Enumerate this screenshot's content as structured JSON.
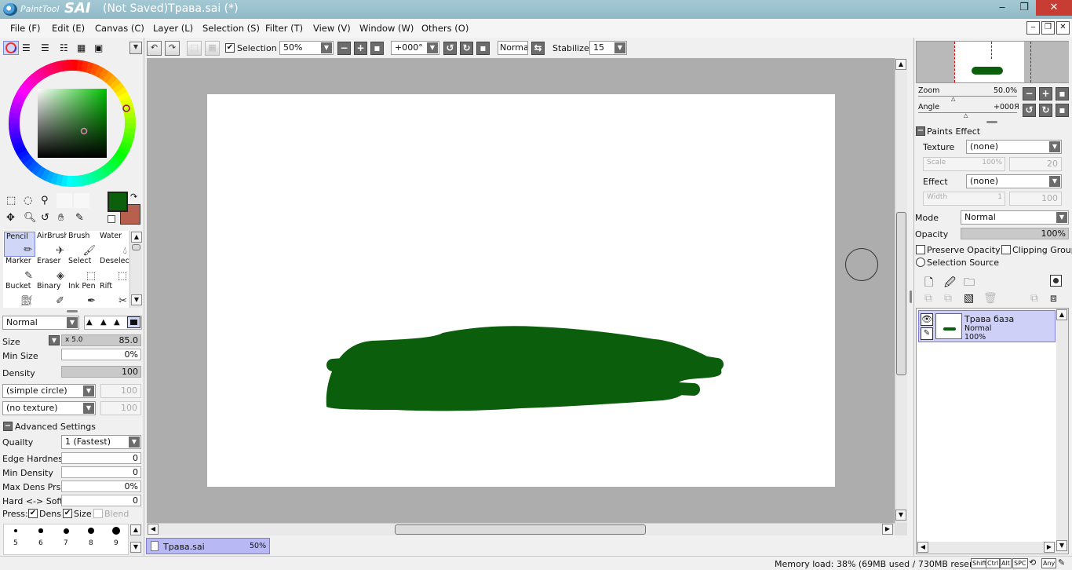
{
  "app": {
    "title": "(Not Saved)Трава.sai (*)",
    "logo_text": "PaintTool",
    "logo_brand": "SAI",
    "window_controls": [
      "‒",
      "❐",
      "✕"
    ]
  },
  "menu": [
    "File (F)",
    "Edit (E)",
    "Canvas (C)",
    "Layer (L)",
    "Selection (S)",
    "Filter (T)",
    "View (V)",
    "Window (W)",
    "Others (O)"
  ],
  "toolbar": {
    "selection_label": "Selection",
    "selection_checked": true,
    "zoom": "50%",
    "rotation": "+000°",
    "blend_mode": "Normal",
    "stabilizer_label": "Stabilizer",
    "stabilizer_value": "15"
  },
  "colors": {
    "primary": "#0c5f0c",
    "secondary": "#b8604e",
    "stroke": "#0b5e0c",
    "selection_bg": "#cfd0f8"
  },
  "tools": [
    {
      "label": "Pencil",
      "icon": "pencil-icon",
      "selected": true
    },
    {
      "label": "AirBrush",
      "icon": "airbrush-icon"
    },
    {
      "label": "Brush",
      "icon": "brush-icon"
    },
    {
      "label": "Water",
      "icon": "water-icon"
    },
    {
      "label": "Marker",
      "icon": "marker-icon"
    },
    {
      "label": "Eraser",
      "icon": "eraser-icon"
    },
    {
      "label": "Select",
      "icon": "select-icon"
    },
    {
      "label": "Deselect",
      "icon": "deselect-icon"
    },
    {
      "label": "Bucket",
      "icon": "bucket-icon"
    },
    {
      "label": "Binary",
      "icon": "binary-icon"
    },
    {
      "label": "Ink Pen",
      "icon": "ink-pen-icon"
    },
    {
      "label": "Rift",
      "icon": "rift-icon"
    }
  ],
  "brush": {
    "mode": "Normal",
    "size_label": "Size",
    "size_mult": "x 5.0",
    "size_value": "85.0",
    "min_size_label": "Min Size",
    "min_size_value": "0%",
    "density_label": "Density",
    "density_value": "100",
    "density_fraction": 1.0,
    "shape": "(simple circle)",
    "shape_value": "100",
    "texture": "(no texture)",
    "texture_value": "100"
  },
  "advanced": {
    "header": "Advanced Settings",
    "quality_label": "Quailty",
    "quality_value": "1 (Fastest)",
    "edge_hardness_label": "Edge Hardness",
    "edge_hardness_value": "0",
    "min_density_label": "Min Density",
    "min_density_value": "0",
    "max_dens_label": "Max Dens Prs.",
    "max_dens_value": "0%",
    "hard_soft_label": "Hard <-> Soft",
    "hard_soft_value": "0",
    "press_label": "Press:",
    "press_dens": "Dens",
    "press_size": "Size",
    "press_blend": "Blend"
  },
  "brush_sizes": [
    "5",
    "6",
    "7",
    "8",
    "9"
  ],
  "navigator": {
    "zoom_label": "Zoom",
    "zoom_value": "50.0%",
    "angle_label": "Angle",
    "angle_value": "+000Я"
  },
  "paints_effect": {
    "header": "Paints Effect",
    "texture_label": "Texture",
    "texture_value": "(none)",
    "scale_label": "Scale",
    "scale_value": "100%",
    "scale_strength": "20",
    "effect_label": "Effect",
    "effect_value": "(none)",
    "width_label": "Width",
    "width_value": "1",
    "width_strength": "100"
  },
  "layer_props": {
    "mode_label": "Mode",
    "mode_value": "Normal",
    "opacity_label": "Opacity",
    "opacity_value": "100%",
    "preserve_opacity": "Preserve Opacity",
    "clipping_group": "Clipping Group",
    "selection_source": "Selection Source"
  },
  "layers": [
    {
      "name": "Трава база",
      "mode": "Normal",
      "opacity": "100%"
    }
  ],
  "document_tab": {
    "name": "Трава.sai",
    "zoom": "50%"
  },
  "status": {
    "memory": "Memory load: 38% (69MB used / 730MB reserved)",
    "keys": [
      "Shift",
      "Ctrl",
      "Alt",
      "SPC",
      "Any"
    ]
  }
}
